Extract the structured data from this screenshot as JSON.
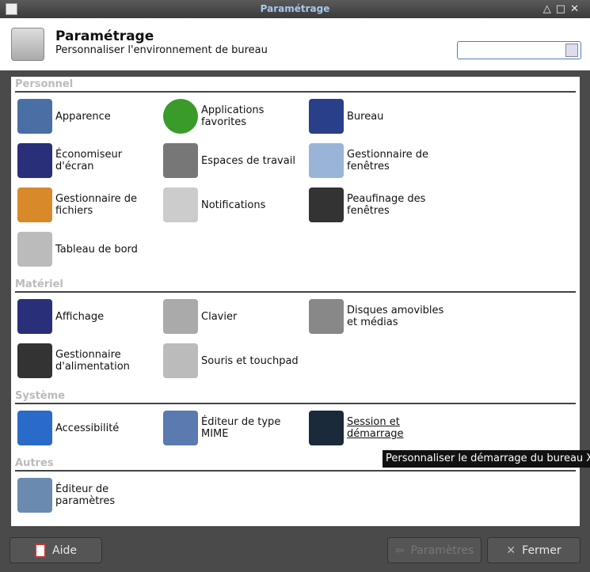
{
  "window": {
    "title": "Paramétrage",
    "controls": [
      "△",
      "□",
      "✕"
    ]
  },
  "header": {
    "title": "Paramétrage",
    "subtitle": "Personnaliser l'environnement de bureau",
    "search_value": ""
  },
  "sections": [
    {
      "title": "Personnel",
      "items": [
        {
          "label": "Apparence",
          "icon": "appearance-icon",
          "color": "#4a6fa5"
        },
        {
          "label": "Applications favorites",
          "icon": "checkmark-icon",
          "color": "#3a9a2a"
        },
        {
          "label": "Bureau",
          "icon": "desktop-icon",
          "color": "#2a3f8a"
        },
        {
          "label": "Économiseur d'écran",
          "icon": "screensaver-icon",
          "color": "#2a2f7a"
        },
        {
          "label": "Espaces de travail",
          "icon": "workspaces-icon",
          "color": "#777777"
        },
        {
          "label": "Gestionnaire de fenêtres",
          "icon": "windows-icon",
          "color": "#9ab4d8"
        },
        {
          "label": "Gestionnaire de fichiers",
          "icon": "file-cabinet-icon",
          "color": "#d88a2a"
        },
        {
          "label": "Notifications",
          "icon": "notifications-icon",
          "color": "#cccccc"
        },
        {
          "label": "Peaufinage des fenêtres",
          "icon": "window-tweaks-icon",
          "color": "#333333"
        },
        {
          "label": "Tableau de bord",
          "icon": "panel-icon",
          "color": "#bbbbbb"
        }
      ]
    },
    {
      "title": "Matériel",
      "items": [
        {
          "label": "Affichage",
          "icon": "display-icon",
          "color": "#2a2f7a"
        },
        {
          "label": "Clavier",
          "icon": "keyboard-icon",
          "color": "#aaaaaa"
        },
        {
          "label": "Disques amovibles et médias",
          "icon": "drive-icon",
          "color": "#888888"
        },
        {
          "label": "Gestionnaire d'alimentation",
          "icon": "power-icon",
          "color": "#333333"
        },
        {
          "label": "Souris et touchpad",
          "icon": "mouse-icon",
          "color": "#bbbbbb"
        }
      ]
    },
    {
      "title": "Système",
      "items": [
        {
          "label": "Accessibilité",
          "icon": "accessibility-icon",
          "color": "#2a6ac8"
        },
        {
          "label": "Éditeur de type MIME",
          "icon": "mime-icon",
          "color": "#5a7ab0"
        },
        {
          "label": "Session et démarrage",
          "icon": "session-icon",
          "color": "#1a2a3a"
        }
      ]
    },
    {
      "title": "Autres",
      "items": [
        {
          "label": "Éditeur de paramètres",
          "icon": "tools-icon",
          "color": "#6a8ab0"
        }
      ]
    }
  ],
  "tooltip": "Personnaliser le démarrage du bureau X",
  "buttons": {
    "help": "Aide",
    "settings": "Paramètres",
    "close": "Fermer"
  }
}
